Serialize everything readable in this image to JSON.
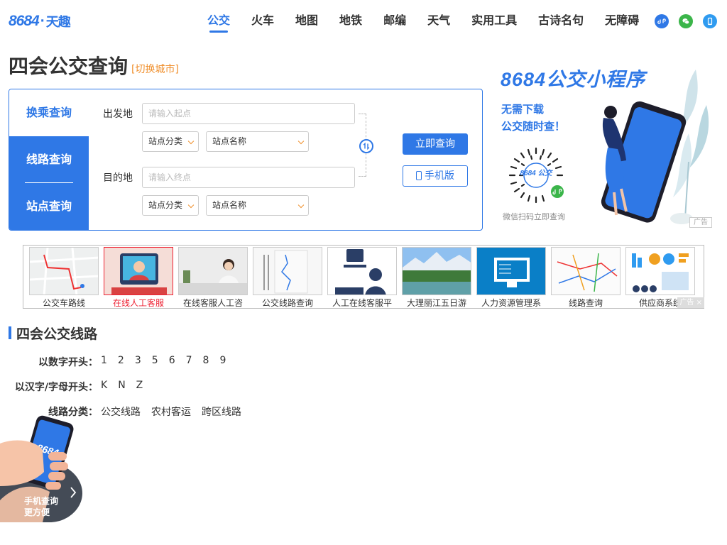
{
  "header": {
    "logo_number": "8684",
    "logo_dot": "·",
    "logo_name": "天趣",
    "nav": [
      "公交",
      "火车",
      "地图",
      "地铁",
      "邮编",
      "天气",
      "实用工具",
      "古诗名句",
      "无障碍"
    ],
    "active_nav": "公交",
    "icons": [
      "miniprogram-icon",
      "wechat-icon",
      "mobile-icon"
    ]
  },
  "page": {
    "title": "四会公交查询",
    "switch_city": "[切换城市]"
  },
  "search": {
    "tabs": {
      "transfer": "换乘查询",
      "line": "线路查询",
      "station": "站点查询"
    },
    "from_label": "出发地",
    "from_placeholder": "请输入起点",
    "to_label": "目的地",
    "to_placeholder": "请输入终点",
    "category_select": "站点分类",
    "name_select": "站点名称",
    "query_button": "立即查询",
    "mobile_button": "手机版"
  },
  "ad_right": {
    "title": "8684公交小程序",
    "line1": "无需下载",
    "line2": "公交随时查！",
    "qr_text": "8684 公交",
    "caption": "微信扫码立即查询",
    "tag": "广告"
  },
  "ad_strip": {
    "items": [
      "公交车路线",
      "在线人工客服",
      "在线客服人工咨",
      "公交线路查询",
      "人工在线客服平",
      "大理丽江五日游",
      "人力资源管理系",
      "线路查询",
      "供应商系统"
    ],
    "close_tag": "广告 ×"
  },
  "lines": {
    "title": "四会公交线路",
    "by_number_label": "以数字开头：",
    "by_number": [
      "1",
      "2",
      "3",
      "5",
      "6",
      "7",
      "8",
      "9"
    ],
    "by_letter_label": "以汉字/字母开头：",
    "by_letter": [
      "K",
      "N",
      "Z"
    ],
    "category_label": "线路分类：",
    "categories": [
      "公交线路",
      "农村客运",
      "跨区线路"
    ]
  },
  "floating": {
    "line1": "手机查询",
    "line2": "更方便",
    "phone_text": "8684"
  },
  "colors": {
    "brand_blue": "#2f78e6",
    "accent_orange": "#f0902e",
    "wechat_green": "#3bb54a",
    "highlight_red": "#e23333"
  }
}
